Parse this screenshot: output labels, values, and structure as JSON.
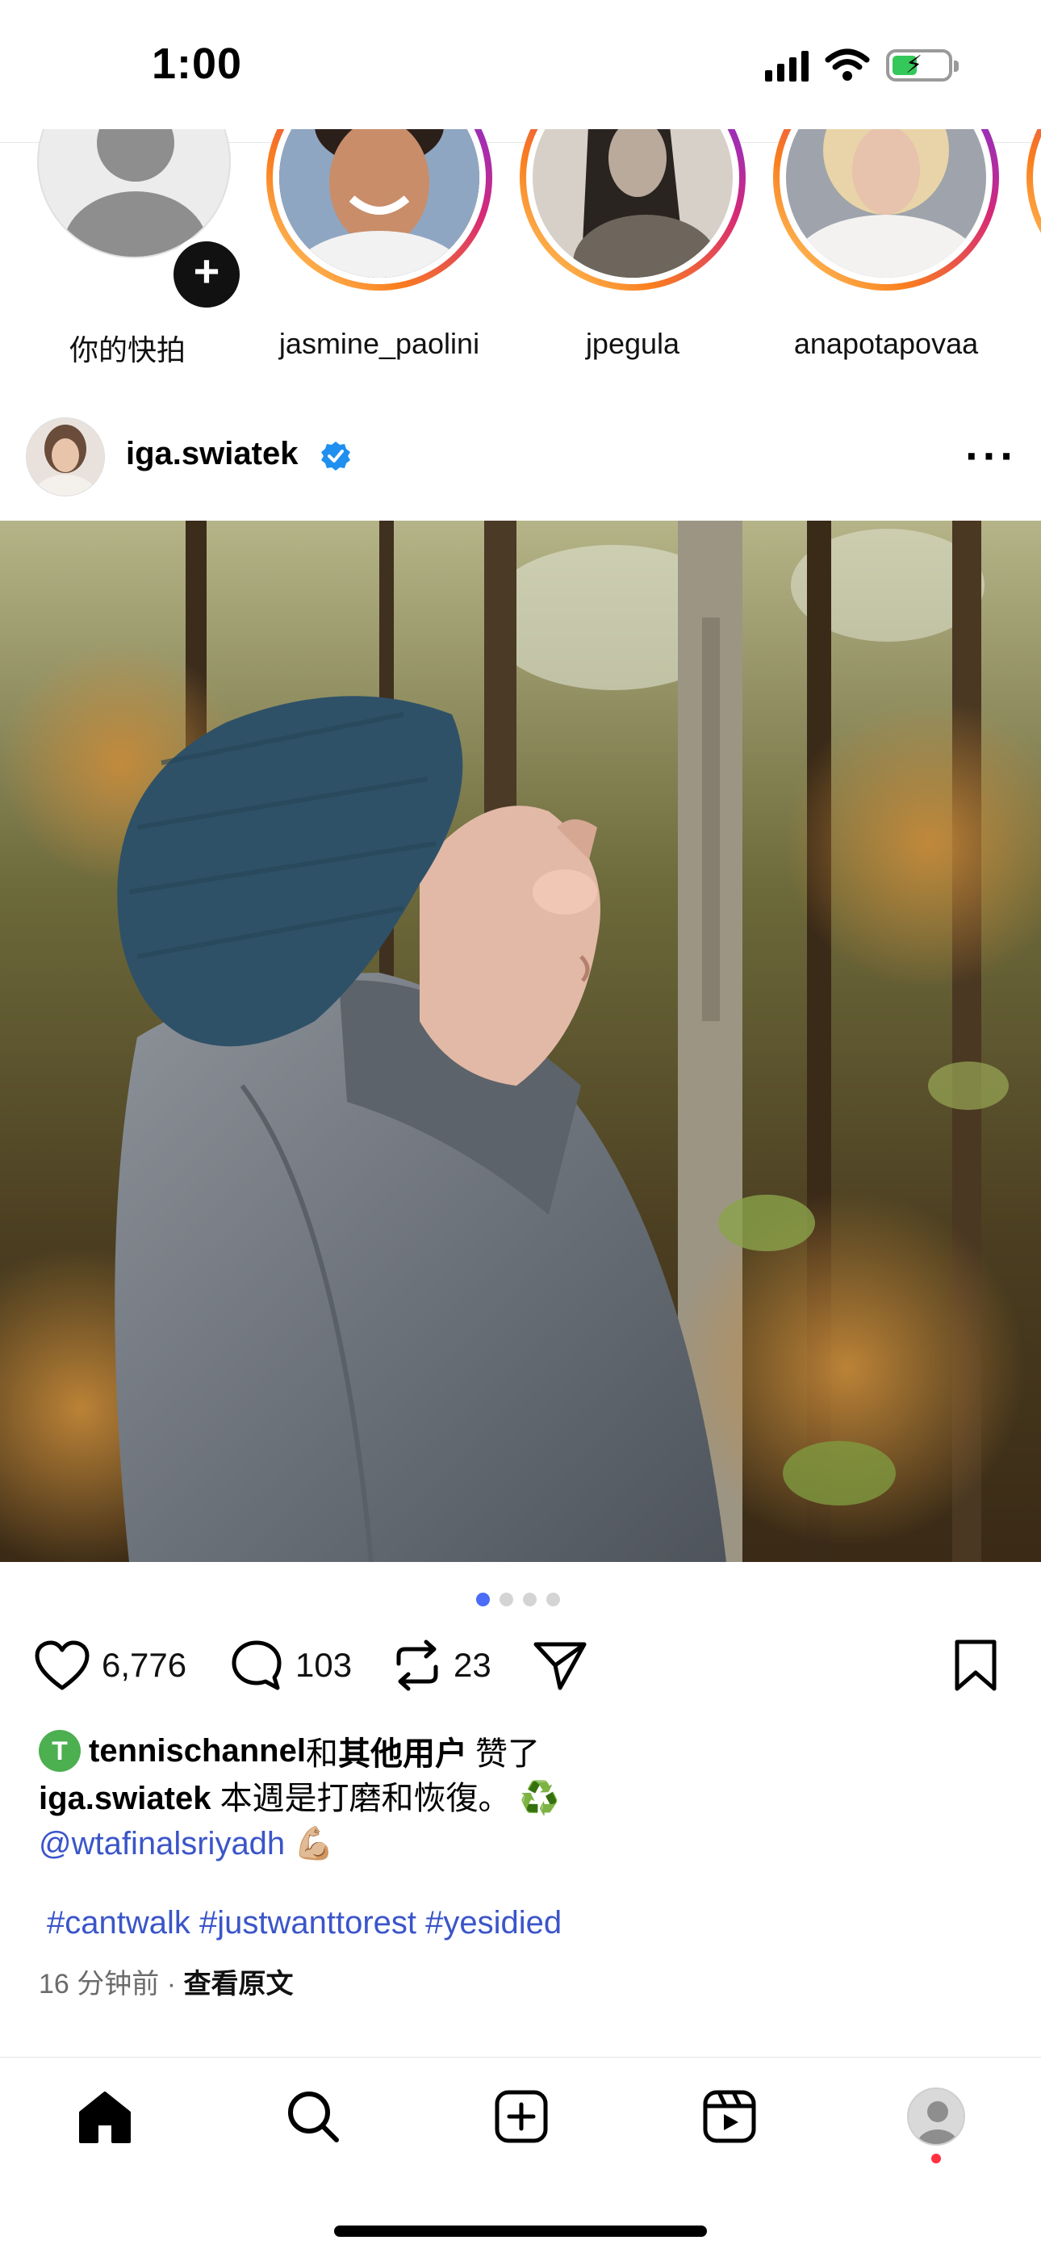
{
  "status_bar": {
    "time": "1:00"
  },
  "stories": [
    {
      "label": "你的快拍",
      "own": true
    },
    {
      "label": "jasmine_paolini"
    },
    {
      "label": "jpegula"
    },
    {
      "label": "anapotapovaa"
    }
  ],
  "post": {
    "username": "iga.swiatek",
    "carousel": {
      "count": 4,
      "active_index": 0
    },
    "actions": {
      "likes": "6,776",
      "comments": "103",
      "reposts": "23"
    },
    "liked_by": {
      "user": "tennischannel",
      "connector": "和",
      "others": "其他用户",
      "suffix": "赞了"
    },
    "caption": {
      "author": "iga.swiatek",
      "text": "本週是打磨和恢復。 ♻️",
      "mention": "@wtafinalsriyadh",
      "emoji": "💪🏼"
    },
    "hashtags": "#cantwalk #justwanttorest #yesidied",
    "timestamp": "16 分钟前",
    "separator": "·",
    "see_original": "查看原文"
  },
  "colors": {
    "accent_blue": "#3b55c9",
    "dot_active": "#4a6cf7",
    "notification_red": "#ff3040",
    "battery_green": "#34c759"
  }
}
